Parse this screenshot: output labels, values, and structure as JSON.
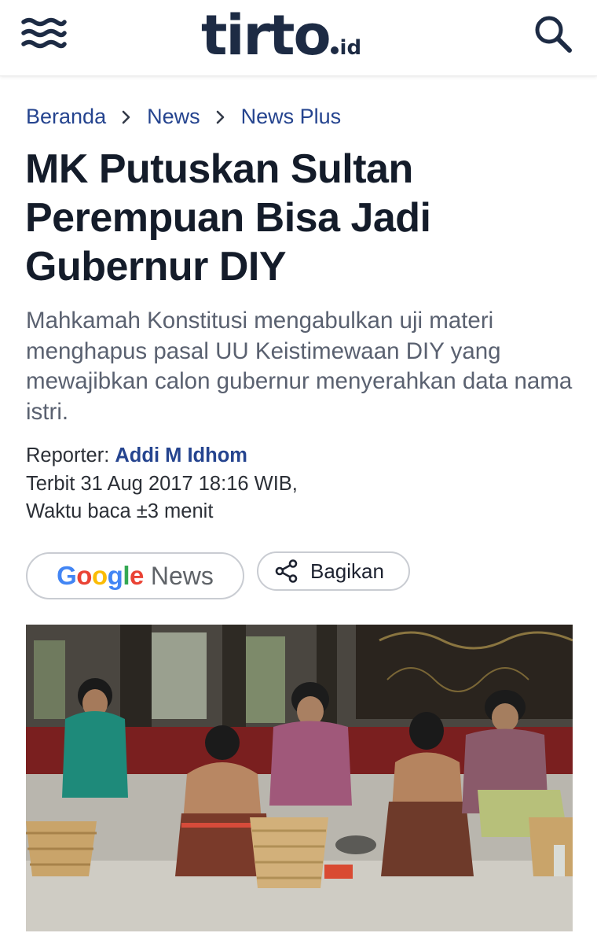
{
  "header": {
    "logo_main": "tirto",
    "logo_suffix": "id",
    "menu_icon": "wave-menu-icon",
    "search_icon": "search-icon",
    "brand_color": "#1d2b44"
  },
  "breadcrumb": {
    "items": [
      "Beranda",
      "News",
      "News Plus"
    ],
    "link_color": "#25448f"
  },
  "article": {
    "title": "MK Putuskan Sultan Perempuan Bisa Jadi Gubernur DIY",
    "lede": "Mahkamah Konstitusi mengabulkan uji materi menghapus pasal UU Keistimewaan DIY yang mewajibkan calon gubernur menyerahkan data nama istri.",
    "reporter_label": "Reporter:",
    "reporter_name": "Addi M Idhom",
    "published": "Terbit 31 Aug 2017 18:16 WIB,",
    "read_time": "Waktu baca ±3 menit"
  },
  "actions": {
    "google_word": "Google",
    "news_label": "News",
    "share_label": "Bagikan",
    "share_icon": "share-icon"
  },
  "hero_image": {
    "alt": "Para abdi dalem perempuan duduk di lantai pendopo keraton"
  }
}
